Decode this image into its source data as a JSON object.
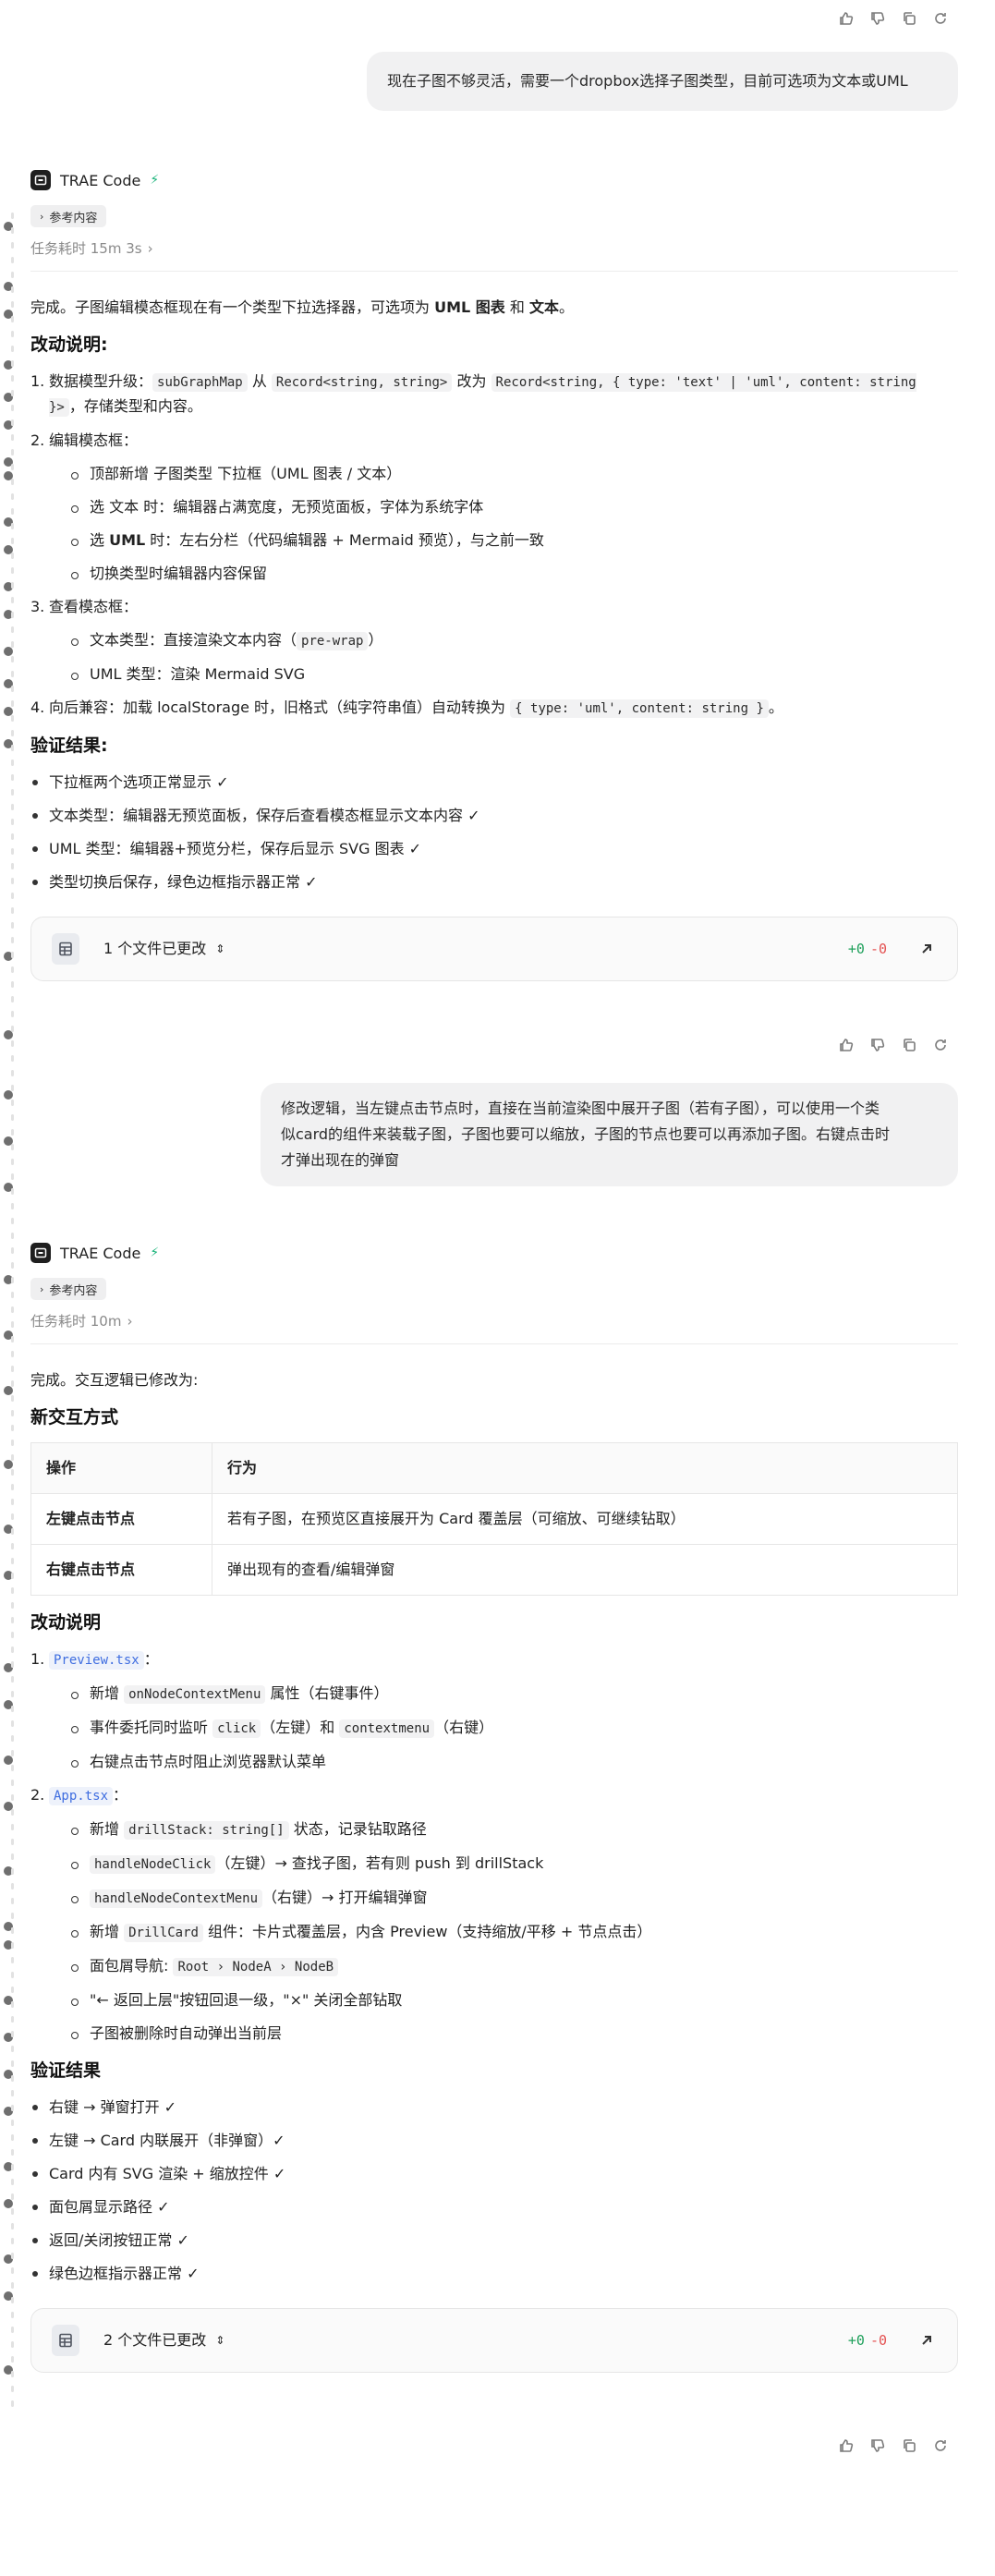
{
  "message1": {
    "user_text": "现在子图不够灵活，需要一个dropbox选择子图类型，目前可选项为文本或UML"
  },
  "agent1": {
    "name": "TRAE Code",
    "ref_label": "参考内容",
    "elapsed": "任务耗时 15m 3s",
    "intro_pre": "完成。子图编辑模态框现在有一个类型下拉选择器，可选项为 ",
    "intro_uml": "UML 图表",
    "intro_and": " 和 ",
    "intro_text": "文本",
    "intro_end": "。",
    "changes_heading": "改动说明:",
    "c1_num": "1.",
    "c1_pre": "数据模型升级：",
    "c1_code1": "subGraphMap",
    "c1_from": " 从 ",
    "c1_code2": "Record<string, string>",
    "c1_to": " 改为 ",
    "c1_code3": "Record<string, { type: 'text' | 'uml', content: string }>",
    "c1_end": "，存储类型和内容。",
    "c2_num": "2.",
    "c2_title": "编辑模态框：",
    "c2_items": [
      "顶部新增 子图类型 下拉框（UML 图表 / 文本）",
      "选 文本 时：编辑器占满宽度，无预览面板，字体为系统字体",
      "选 UML 时：左右分栏（代码编辑器 + Mermaid 预览），与之前一致",
      "切换类型时编辑器内容保留"
    ],
    "c2_b1_pre": "选 ",
    "c2_b1_bold": "文本",
    "c2_b1_post": " 时：编辑器占满宽度，无预览面板，字体为系统字体",
    "c2_b2_pre": "选 ",
    "c2_b2_bold": "UML",
    "c2_b2_post": " 时：左右分栏（代码编辑器 + Mermaid 预览），与之前一致",
    "c3_num": "3.",
    "c3_title": "查看模态框：",
    "c3_i1_pre": "文本类型：直接渲染文本内容（",
    "c3_i1_code": "pre-wrap",
    "c3_i1_post": "）",
    "c3_i2": "UML 类型：渲染 Mermaid SVG",
    "c4_num": "4.",
    "c4_pre": "向后兼容：加载 localStorage 时，旧格式（纯字符串值）自动转换为 ",
    "c4_code": "{ type: 'uml', content: string }",
    "c4_end": "。",
    "verify_heading": "验证结果:",
    "verify_items": [
      "下拉框两个选项正常显示 ✓",
      "文本类型：编辑器无预览面板，保存后查看模态框显示文本内容 ✓",
      "UML 类型：编辑器+预览分栏，保存后显示 SVG 图表 ✓",
      "类型切换后保存，绿色边框指示器正常 ✓"
    ],
    "files_label": "1 个文件已更改",
    "diff_plus": "+0",
    "diff_minus": "-0"
  },
  "message2": {
    "user_line1": "修改逻辑，当左键点击节点时，直接在当前渲染图中展开子图（若有子图），可以使用一个类",
    "user_line2": "似card的组件来装载子图，子图也要可以缩放，子图的节点也要可以再添加子图。右键点击时",
    "user_line3": "才弹出现在的弹窗"
  },
  "agent2": {
    "name": "TRAE Code",
    "ref_label": "参考内容",
    "elapsed": "任务耗时 10m",
    "intro": "完成。交互逻辑已修改为:",
    "mode_heading": "新交互方式",
    "table_headers": [
      "操作",
      "行为"
    ],
    "table_rows": [
      {
        "op": "左键点击节点",
        "behavior": "若有子图，在预览区直接展开为 Card 覆盖层（可缩放、可继续钻取）"
      },
      {
        "op": "右键点击节点",
        "behavior": "弹出现有的查看/编辑弹窗"
      }
    ],
    "changes_heading": "改动说明",
    "p_num": "1.",
    "p_file": "Preview.tsx",
    "p_colon": "：",
    "p_i1_pre": "新增 ",
    "p_i1_code": "onNodeContextMenu",
    "p_i1_post": " 属性（右键事件）",
    "p_i2_pre": "事件委托同时监听 ",
    "p_i2_code1": "click",
    "p_i2_mid": "（左键）和 ",
    "p_i2_code2": "contextmenu",
    "p_i2_post": "（右键）",
    "p_i3": "右键点击节点时阻止浏览器默认菜单",
    "a_num": "2.",
    "a_file": "App.tsx",
    "a_colon": "：",
    "a_i1_pre": "新增 ",
    "a_i1_code": "drillStack: string[]",
    "a_i1_post": " 状态，记录钻取路径",
    "a_i2_code": "handleNodeClick",
    "a_i2_post": "（左键）→ 查找子图，若有则 push 到 drillStack",
    "a_i3_code": "handleNodeContextMenu",
    "a_i3_post": "（右键）→ 打开编辑弹窗",
    "a_i4_pre": "新增 ",
    "a_i4_code": "DrillCard",
    "a_i4_post": " 组件：卡片式覆盖层，内含 Preview（支持缩放/平移 + 节点点击）",
    "a_i5_pre": "面包屑导航: ",
    "a_i5_code": "Root › NodeA › NodeB",
    "a_i6": "\"← 返回上层\"按钮回退一级，\"×\" 关闭全部钻取",
    "a_i7": "子图被删除时自动弹出当前层",
    "verify_heading": "验证结果",
    "verify_items": [
      "右键 → 弹窗打开 ✓",
      "左键 → Card 内联展开（非弹窗）✓",
      "Card 内有 SVG 渲染 + 缩放控件 ✓",
      "面包屑显示路径 ✓",
      "返回/关闭按钮正常 ✓",
      "绿色边框指示器正常 ✓"
    ],
    "files_label": "2 个文件已更改",
    "diff_plus": "+0",
    "diff_minus": "-0"
  }
}
